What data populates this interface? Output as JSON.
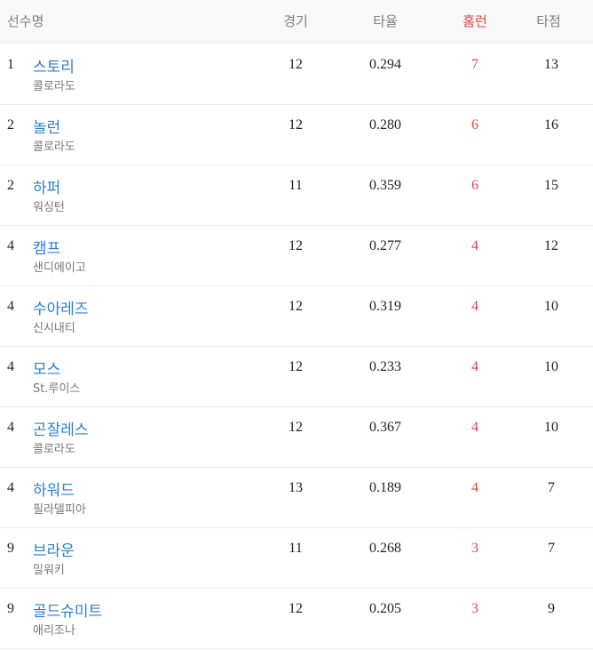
{
  "table": {
    "headers": {
      "name": "선수명",
      "games": "경기",
      "avg": "타율",
      "hr": "홈런",
      "rbi": "타점"
    },
    "rows": [
      {
        "rank": "1",
        "name": "스토리",
        "team": "콜로라도",
        "games": "12",
        "avg": "0.294",
        "hr": "7",
        "rbi": "13"
      },
      {
        "rank": "2",
        "name": "놀런",
        "team": "콜로라도",
        "games": "12",
        "avg": "0.280",
        "hr": "6",
        "rbi": "16"
      },
      {
        "rank": "2",
        "name": "하퍼",
        "team": "워싱턴",
        "games": "11",
        "avg": "0.359",
        "hr": "6",
        "rbi": "15"
      },
      {
        "rank": "4",
        "name": "캠프",
        "team": "샌디에이고",
        "games": "12",
        "avg": "0.277",
        "hr": "4",
        "rbi": "12"
      },
      {
        "rank": "4",
        "name": "수아레즈",
        "team": "신시내티",
        "games": "12",
        "avg": "0.319",
        "hr": "4",
        "rbi": "10"
      },
      {
        "rank": "4",
        "name": "모스",
        "team": "St.루이스",
        "games": "12",
        "avg": "0.233",
        "hr": "4",
        "rbi": "10"
      },
      {
        "rank": "4",
        "name": "곤잘레스",
        "team": "콜로라도",
        "games": "12",
        "avg": "0.367",
        "hr": "4",
        "rbi": "10"
      },
      {
        "rank": "4",
        "name": "하워드",
        "team": "필라델피아",
        "games": "13",
        "avg": "0.189",
        "hr": "4",
        "rbi": "7"
      },
      {
        "rank": "9",
        "name": "브라운",
        "team": "밀워키",
        "games": "11",
        "avg": "0.268",
        "hr": "3",
        "rbi": "7"
      },
      {
        "rank": "9",
        "name": "골드슈미트",
        "team": "애리조나",
        "games": "12",
        "avg": "0.205",
        "hr": "3",
        "rbi": "9"
      }
    ]
  },
  "colors": {
    "player_link": "#2a7fd4",
    "home_run": "#e04545",
    "header_bg": "#f8f8f8"
  }
}
